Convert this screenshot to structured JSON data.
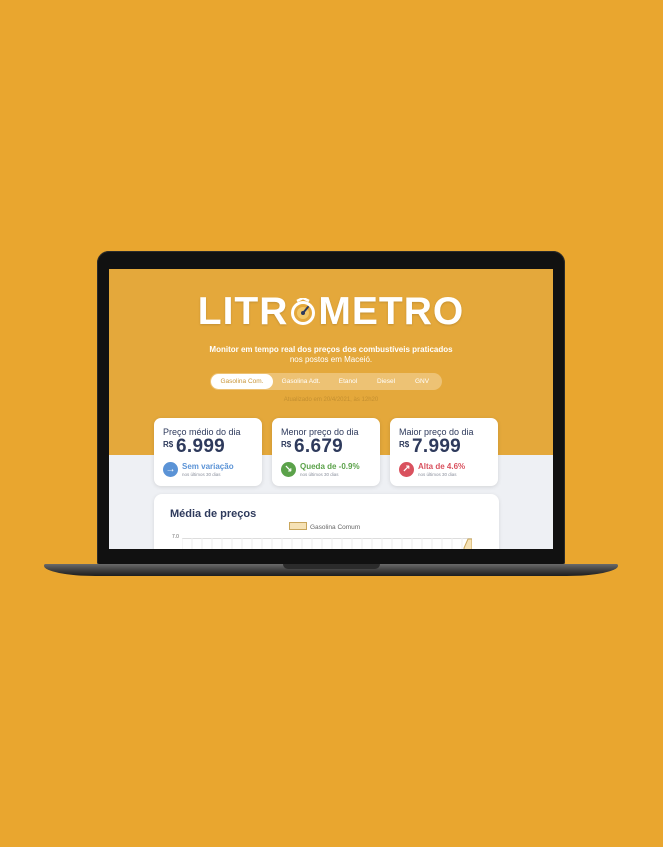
{
  "app": {
    "logo_left": "LITR",
    "logo_right": "METRO",
    "tagline_bold": "Monitor em tempo real dos preços dos combustíveis praticados",
    "tagline_line2": "nos postos em Maceió.",
    "updated": "Atualizado em 20/4/2021, às 12h20"
  },
  "tabs": [
    {
      "label": "Gasolina Com.",
      "active": true
    },
    {
      "label": "Gasolina Adt.",
      "active": false
    },
    {
      "label": "Etanol",
      "active": false
    },
    {
      "label": "Diesel",
      "active": false
    },
    {
      "label": "GNV",
      "active": false
    }
  ],
  "cards": [
    {
      "title": "Preço médio do dia",
      "currency": "R$",
      "value": "6.999",
      "trend": "Sem variação",
      "sub": "nos últimos 30 dias",
      "icon": "arrow-right-icon",
      "color": "#5B93D6"
    },
    {
      "title": "Menor preço do dia",
      "currency": "R$",
      "value": "6.679",
      "trend": "Queda de -0.9%",
      "sub": "nos últimos 30 dias",
      "icon": "arrow-down-right-icon",
      "color": "#5BA24A"
    },
    {
      "title": "Maior preço do dia",
      "currency": "R$",
      "value": "7.999",
      "trend": "Alta de 4.6%",
      "sub": "nos últimos 30 dias",
      "icon": "arrow-up-right-icon",
      "color": "#D9515E"
    }
  ],
  "chart": {
    "title": "Média de preços",
    "legend": "Gasolina Comum",
    "y_tick": "7.0"
  },
  "colors": {
    "page_bg": "#E9A62F",
    "hero_bg": "#E4A83B",
    "navy": "#2E3A5C"
  }
}
